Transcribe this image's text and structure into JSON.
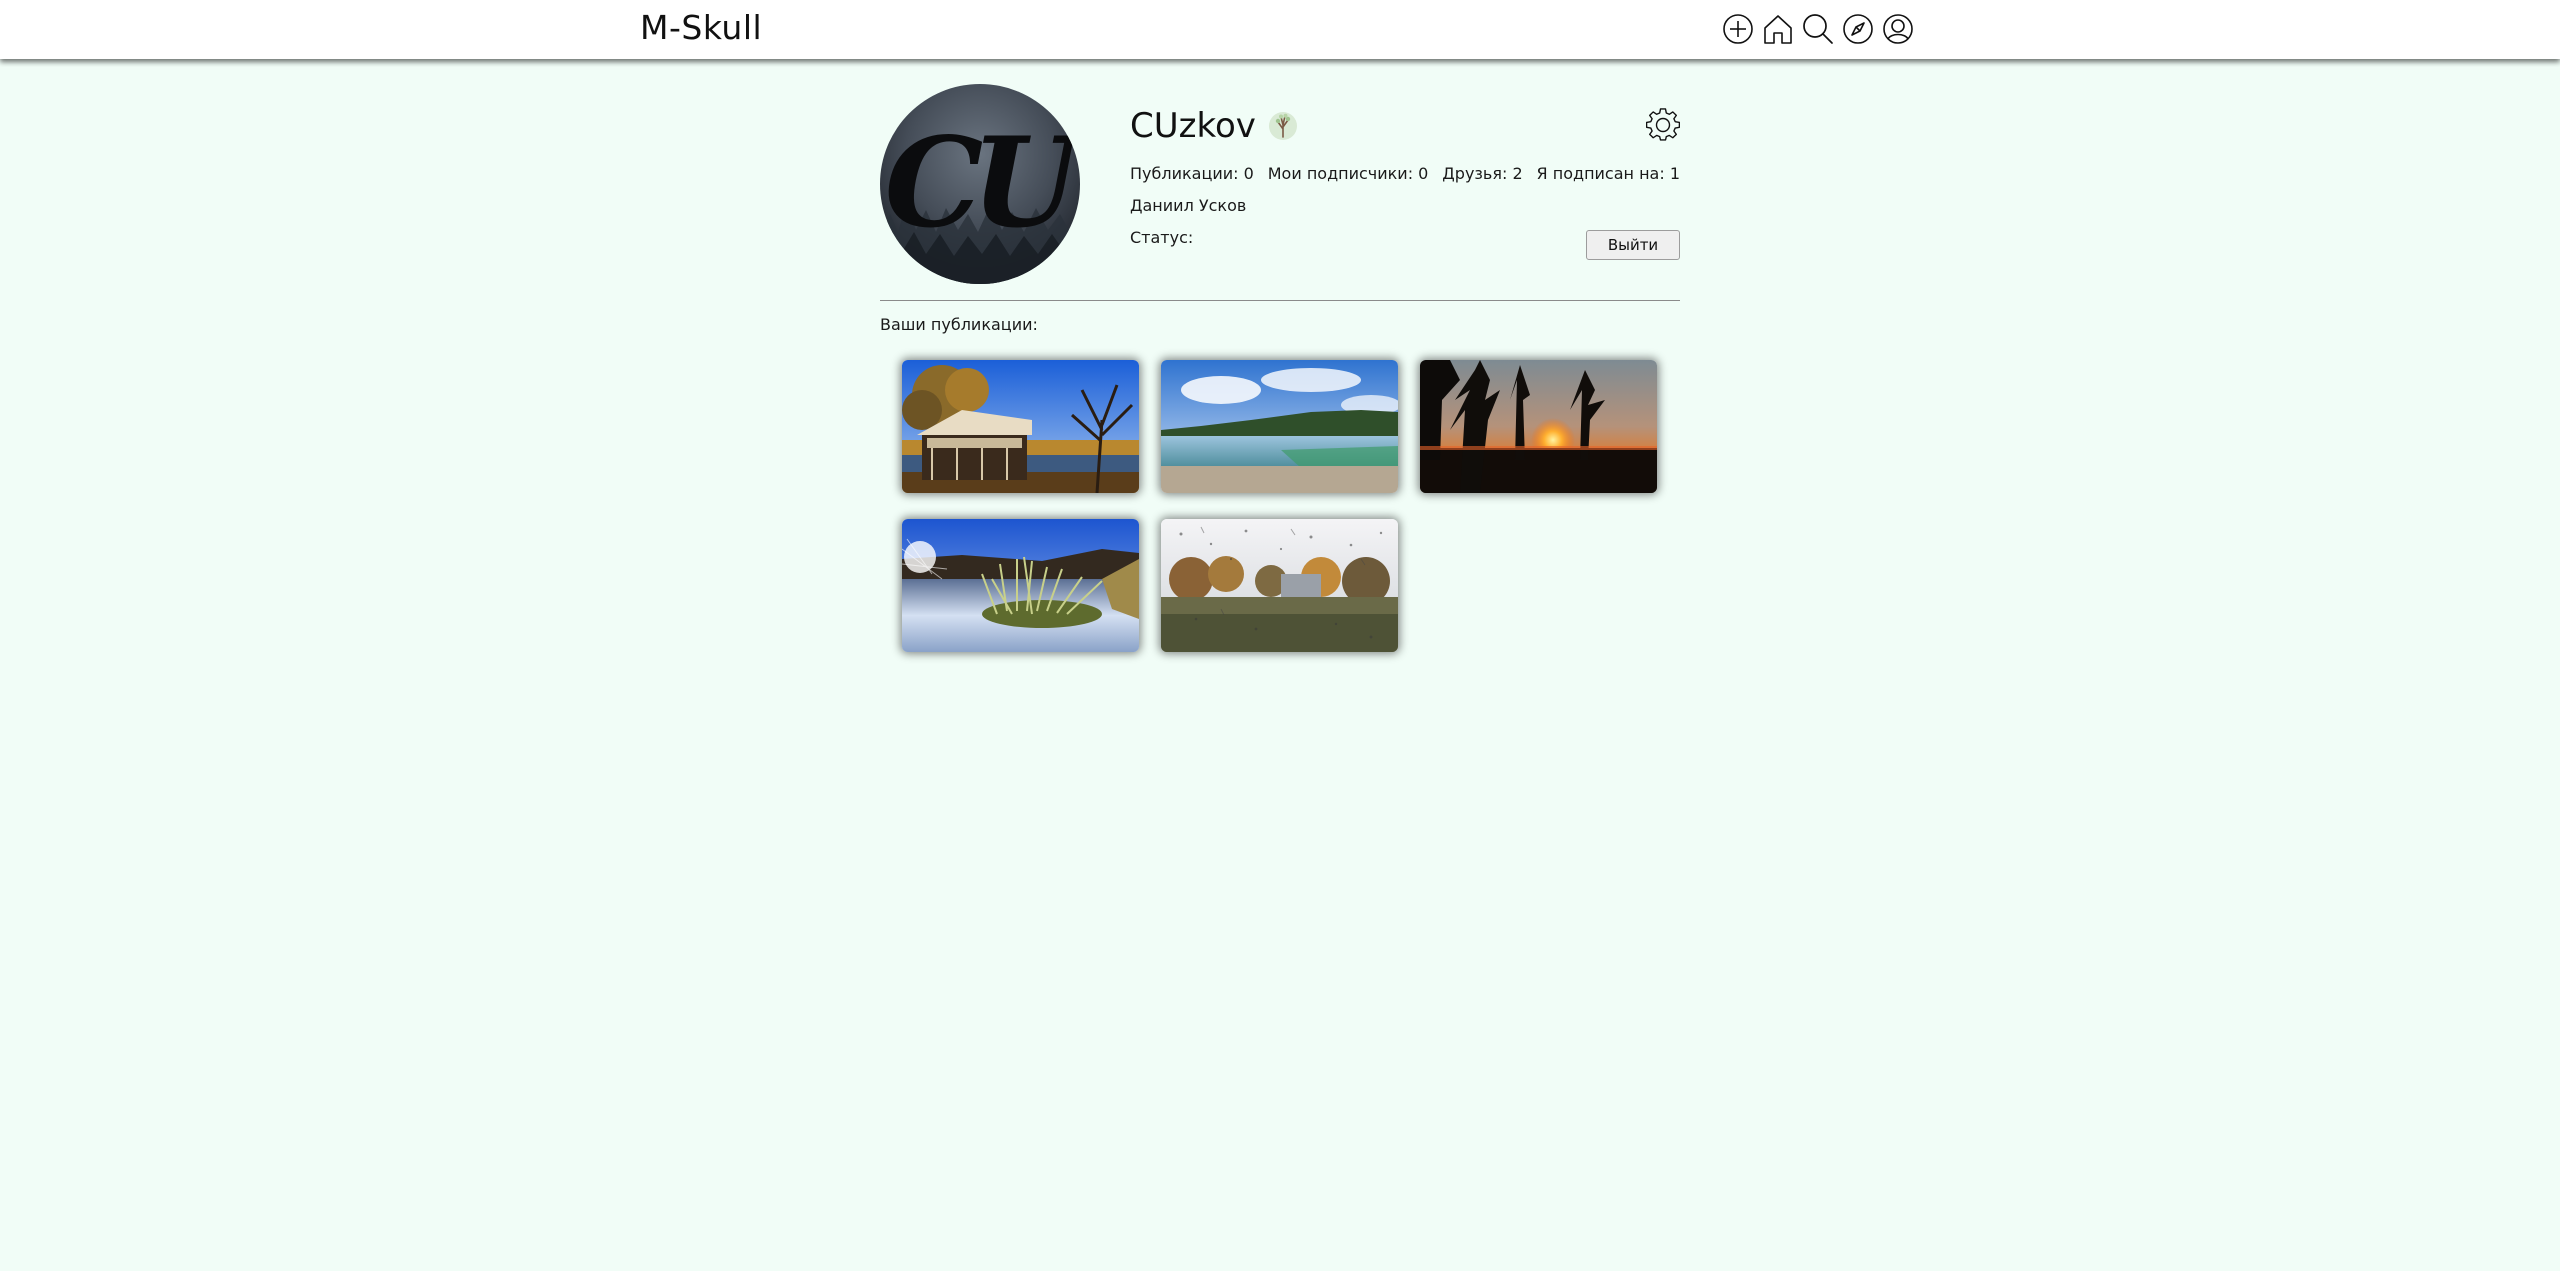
{
  "header": {
    "logo": "M-Skull",
    "nav_icons": [
      "plus-circle-icon",
      "home-icon",
      "search-icon",
      "compass-icon",
      "user-circle-icon"
    ]
  },
  "profile": {
    "avatar_monogram": "CU",
    "username": "CUzkov",
    "badge_icon": "tree-icon",
    "stats": {
      "publications": "Публикации: 0",
      "followers": "Мои подписчики: 0",
      "friends": "Друзья: 2",
      "following": "Я подписан на: 1"
    },
    "full_name": "Даниил Усков",
    "status_label": "Статус:",
    "logout_label": "Выйти",
    "settings_icon": "gear-icon"
  },
  "publications": {
    "title": "Ваши публикации:",
    "items": [
      {
        "scene": "gazebo-by-lake-autumn"
      },
      {
        "scene": "lake-with-forest-shore"
      },
      {
        "scene": "sunset-through-pines"
      },
      {
        "scene": "grass-tuft-in-lake"
      },
      {
        "scene": "rainy-window-autumn-trees"
      }
    ]
  },
  "colors": {
    "page_background": "#f1fdf7",
    "header_background": "#ffffff",
    "text": "#1a1a1a"
  }
}
